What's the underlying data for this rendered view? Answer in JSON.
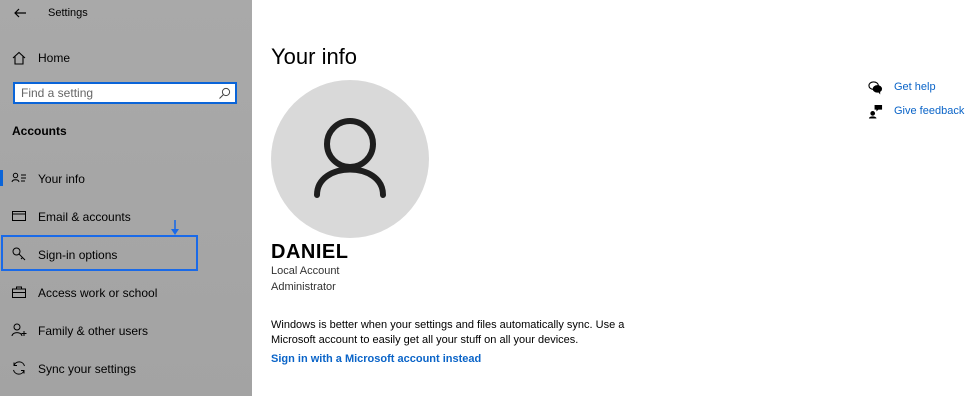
{
  "app": {
    "title": "Settings"
  },
  "sidebar": {
    "home_label": "Home",
    "search_placeholder": "Find a setting",
    "section_title": "Accounts",
    "items": [
      {
        "label": "Your info",
        "icon": "person-card-icon",
        "active": true
      },
      {
        "label": "Email & accounts",
        "icon": "mail-icon"
      },
      {
        "label": "Sign-in options",
        "icon": "key-icon",
        "highlighted": true
      },
      {
        "label": "Access work or school",
        "icon": "briefcase-icon"
      },
      {
        "label": "Family & other users",
        "icon": "person-add-icon"
      },
      {
        "label": "Sync your settings",
        "icon": "sync-icon"
      }
    ]
  },
  "main": {
    "title": "Your info",
    "user_name": "DANIEL",
    "account_type": "Local Account",
    "account_role": "Administrator",
    "sync_text": "Windows is better when your settings and files automatically sync. Use a Microsoft account to easily get all your stuff on all your devices.",
    "ms_link": "Sign in with a Microsoft account instead",
    "help": [
      {
        "label": "Get help",
        "icon": "chat-help-icon"
      },
      {
        "label": "Give feedback",
        "icon": "feedback-icon"
      }
    ]
  },
  "colors": {
    "accent": "#0a64d8",
    "link": "#0a64c8",
    "sidebar_bg": "#a8a8a8",
    "avatar_bg": "#d9d9d9"
  }
}
